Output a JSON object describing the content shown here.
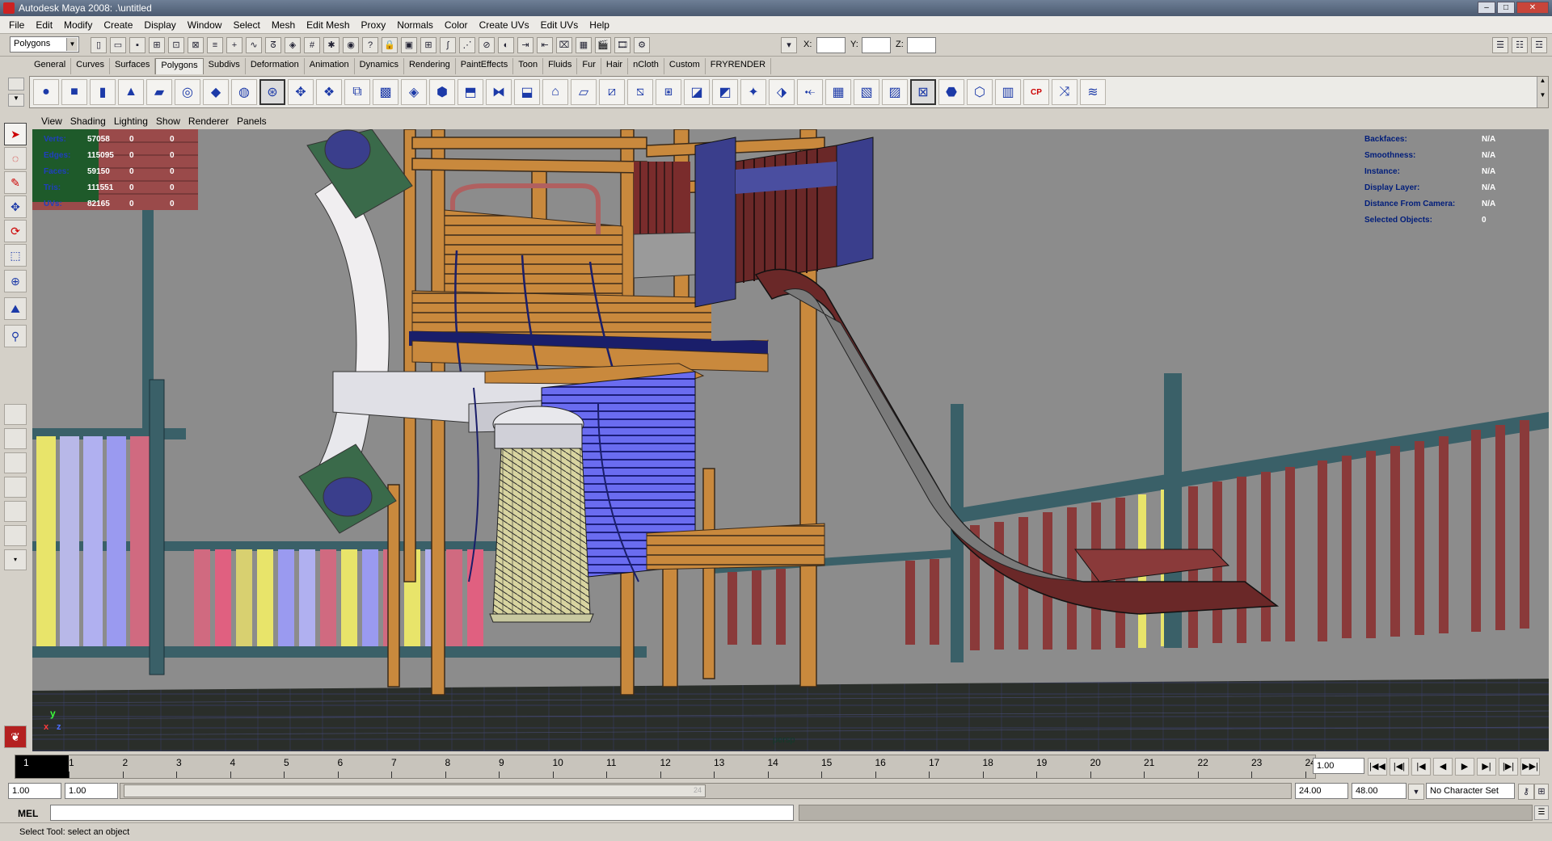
{
  "window": {
    "title": "Autodesk Maya 2008: .\\untitled"
  },
  "menubar": [
    "File",
    "Edit",
    "Modify",
    "Create",
    "Display",
    "Window",
    "Select",
    "Mesh",
    "Edit Mesh",
    "Proxy",
    "Normals",
    "Color",
    "Create UVs",
    "Edit UVs",
    "Help"
  ],
  "status_line": {
    "mode": "Polygons",
    "x_label": "X:",
    "y_label": "Y:",
    "z_label": "Z:",
    "x_value": "",
    "y_value": "",
    "z_value": ""
  },
  "shelf": {
    "tabs": [
      "General",
      "Curves",
      "Surfaces",
      "Polygons",
      "Subdivs",
      "Deformation",
      "Animation",
      "Dynamics",
      "Rendering",
      "PaintEffects",
      "Toon",
      "Fluids",
      "Fur",
      "Hair",
      "nCloth",
      "Custom",
      "FRYRENDER"
    ],
    "active_tab": "Polygons",
    "icons": [
      "poly-sphere-icon",
      "poly-cube-icon",
      "poly-cylinder-icon",
      "poly-cone-icon",
      "poly-plane-icon",
      "poly-torus-icon",
      "poly-prism-icon",
      "poly-pipe-icon",
      "poly-helix-icon",
      "poly-soccerball-icon",
      "poly-platonic-icon",
      "combine-icon",
      "separate-icon",
      "smooth-icon",
      "boolean-icon",
      "extract-icon",
      "mirror-icon",
      "extrude-icon",
      "bridge-icon",
      "append-polygon-icon",
      "split-polygon-icon",
      "insert-edgeloop-icon",
      "offset-edgeloop-icon",
      "cut-faces-icon",
      "wedge-icon",
      "poke-icon",
      "bevel-icon",
      "merge-icon",
      "collapse-icon",
      "planar-uv-icon",
      "cylindrical-uv-icon",
      "spherical-uv-icon",
      "automatic-uv-icon",
      "uv-editor-icon",
      "sculpt-icon",
      "cp-icon",
      "transfer-icon",
      "normal-icon"
    ],
    "cp_label": "CP"
  },
  "toolbox": [
    "select-tool-icon",
    "lasso-tool-icon",
    "paint-select-icon",
    "move-tool-icon",
    "rotate-tool-icon",
    "scale-tool-icon",
    "universal-manip-icon",
    "soft-mod-icon",
    "show-manip-icon",
    "last-tool-icon"
  ],
  "panel_menu": [
    "View",
    "Shading",
    "Lighting",
    "Show",
    "Renderer",
    "Panels"
  ],
  "hud_left": [
    {
      "label": "Verts:",
      "v1": "57058",
      "v2": "0",
      "v3": "0"
    },
    {
      "label": "Edges:",
      "v1": "115095",
      "v2": "0",
      "v3": "0"
    },
    {
      "label": "Faces:",
      "v1": "59150",
      "v2": "0",
      "v3": "0"
    },
    {
      "label": "Tris:",
      "v1": "111551",
      "v2": "0",
      "v3": "0"
    },
    {
      "label": "UVs:",
      "v1": "82165",
      "v2": "0",
      "v3": "0"
    }
  ],
  "hud_right": [
    {
      "label": "Backfaces:",
      "value": "N/A"
    },
    {
      "label": "Smoothness:",
      "value": "N/A"
    },
    {
      "label": "Instance:",
      "value": "N/A"
    },
    {
      "label": "Display Layer:",
      "value": "N/A"
    },
    {
      "label": "Distance From Camera:",
      "value": "N/A"
    },
    {
      "label": "Selected Objects:",
      "value": "0"
    }
  ],
  "camera_label": "persp",
  "axes": {
    "x": "x",
    "y": "y",
    "z": "z"
  },
  "time_slider": {
    "ticks": [
      "1",
      "2",
      "3",
      "4",
      "5",
      "6",
      "7",
      "8",
      "9",
      "10",
      "11",
      "12",
      "13",
      "14",
      "15",
      "16",
      "17",
      "18",
      "19",
      "20",
      "21",
      "22",
      "23",
      "24"
    ],
    "current_frame": "1",
    "current_time_field": "1.00"
  },
  "range_slider": {
    "start_time": "1.00",
    "range_start": "1.00",
    "range_end": "24.00",
    "end_time": "48.00",
    "handle_end_label": "24",
    "character_set": "No Character Set"
  },
  "playback_buttons": [
    "go-to-start-icon",
    "step-back-key-icon",
    "step-back-frame-icon",
    "play-backward-icon",
    "play-forward-icon",
    "step-forward-frame-icon",
    "step-forward-key-icon",
    "go-to-end-icon"
  ],
  "command_line": {
    "label": "MEL",
    "input_value": ""
  },
  "help_line": "Select Tool: select an object",
  "colors": {
    "viewport_bg": "#8c8c8c",
    "hud_label": "#1f3fc0",
    "wood": "#c9893d",
    "slide": "#6a2828",
    "panel_blue": "#3a3e8c"
  }
}
